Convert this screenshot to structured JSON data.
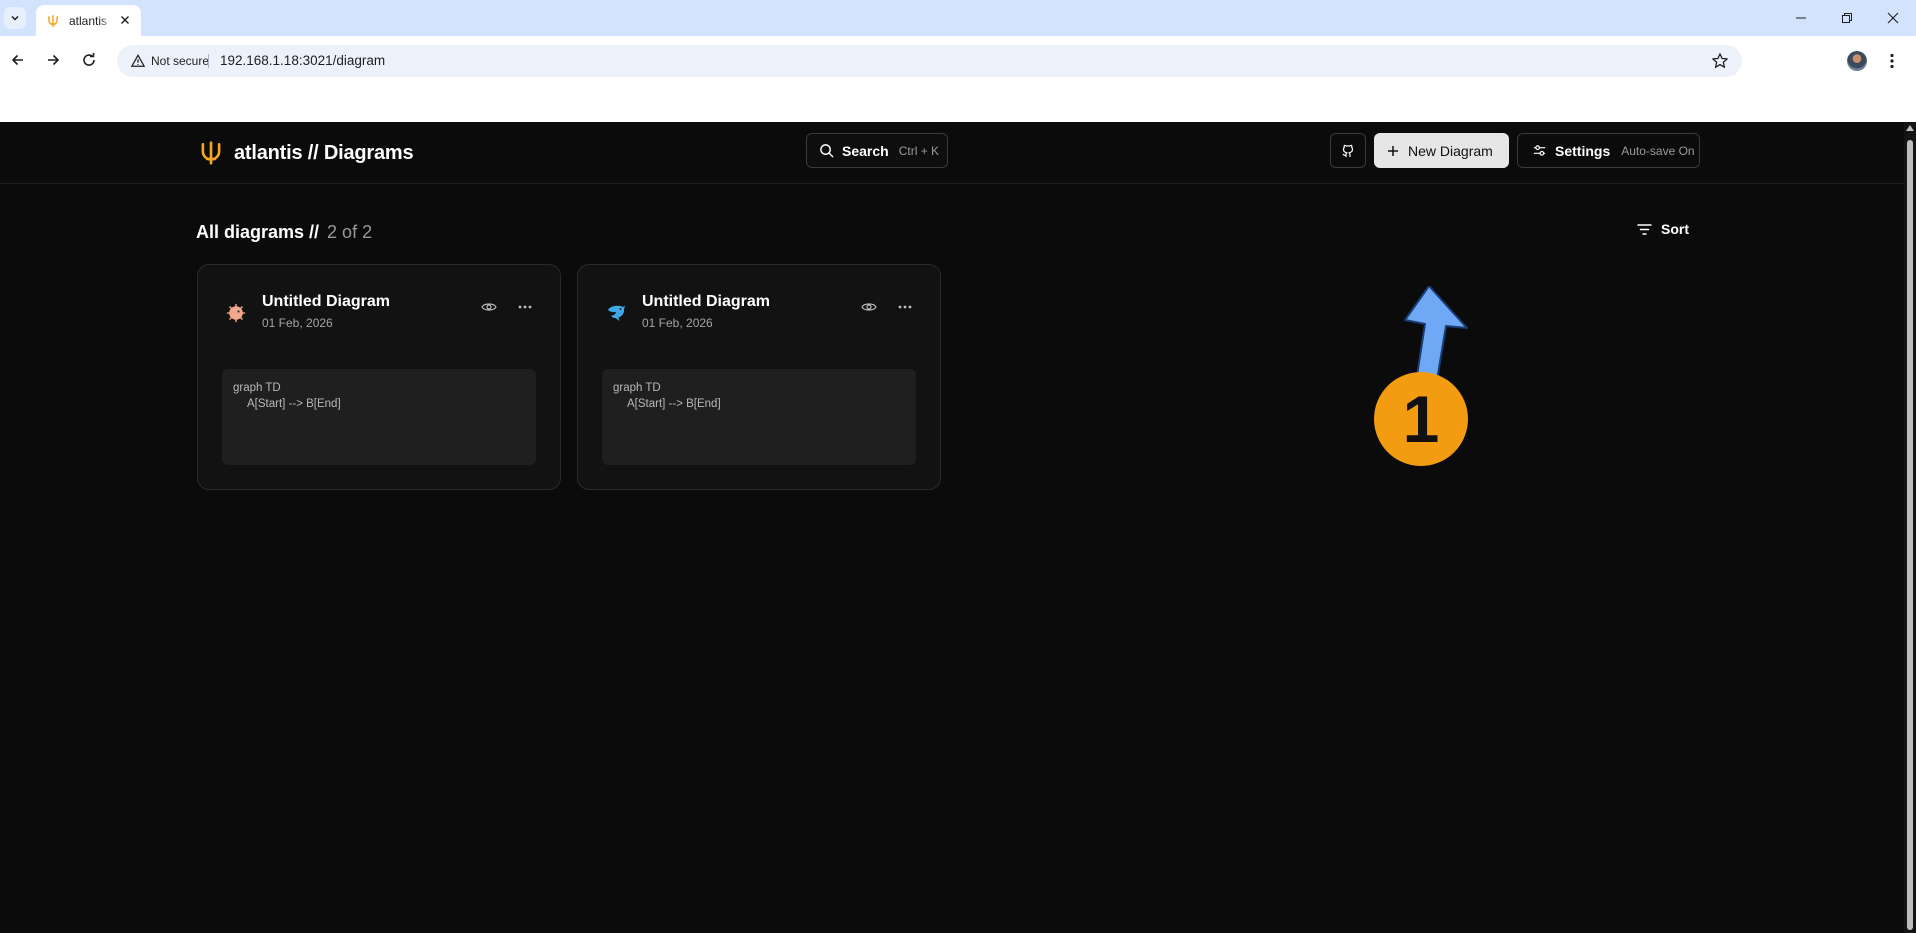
{
  "browser": {
    "tab_title": "atlantis",
    "security_label": "Not secure",
    "url": "192.168.1.18:3021/diagram"
  },
  "header": {
    "brand_title": "atlantis // Diagrams",
    "search_label": "Search",
    "search_shortcut": "Ctrl + K",
    "new_diagram_label": "New Diagram",
    "settings_label": "Settings",
    "settings_status": "Auto-save On"
  },
  "listing": {
    "title": "All diagrams //",
    "count": "2 of 2",
    "sort_label": "Sort"
  },
  "diagrams": [
    {
      "title": "Untitled Diagram",
      "date": "01 Feb, 2026",
      "icon": "pufferfish-icon",
      "code_line1": "graph TD",
      "code_line2": "A[Start] --> B[End]"
    },
    {
      "title": "Untitled Diagram",
      "date": "01 Feb, 2026",
      "icon": "dolphin-icon",
      "code_line1": "graph TD",
      "code_line2": "A[Start] --> B[End]"
    }
  ],
  "annotation": {
    "step_number": "1",
    "color": "#f39c12",
    "arrow_color": "#6fa8f5"
  },
  "colors": {
    "accent_brand": "#f5a623",
    "background": "#0b0b0b",
    "card": "#121212"
  }
}
